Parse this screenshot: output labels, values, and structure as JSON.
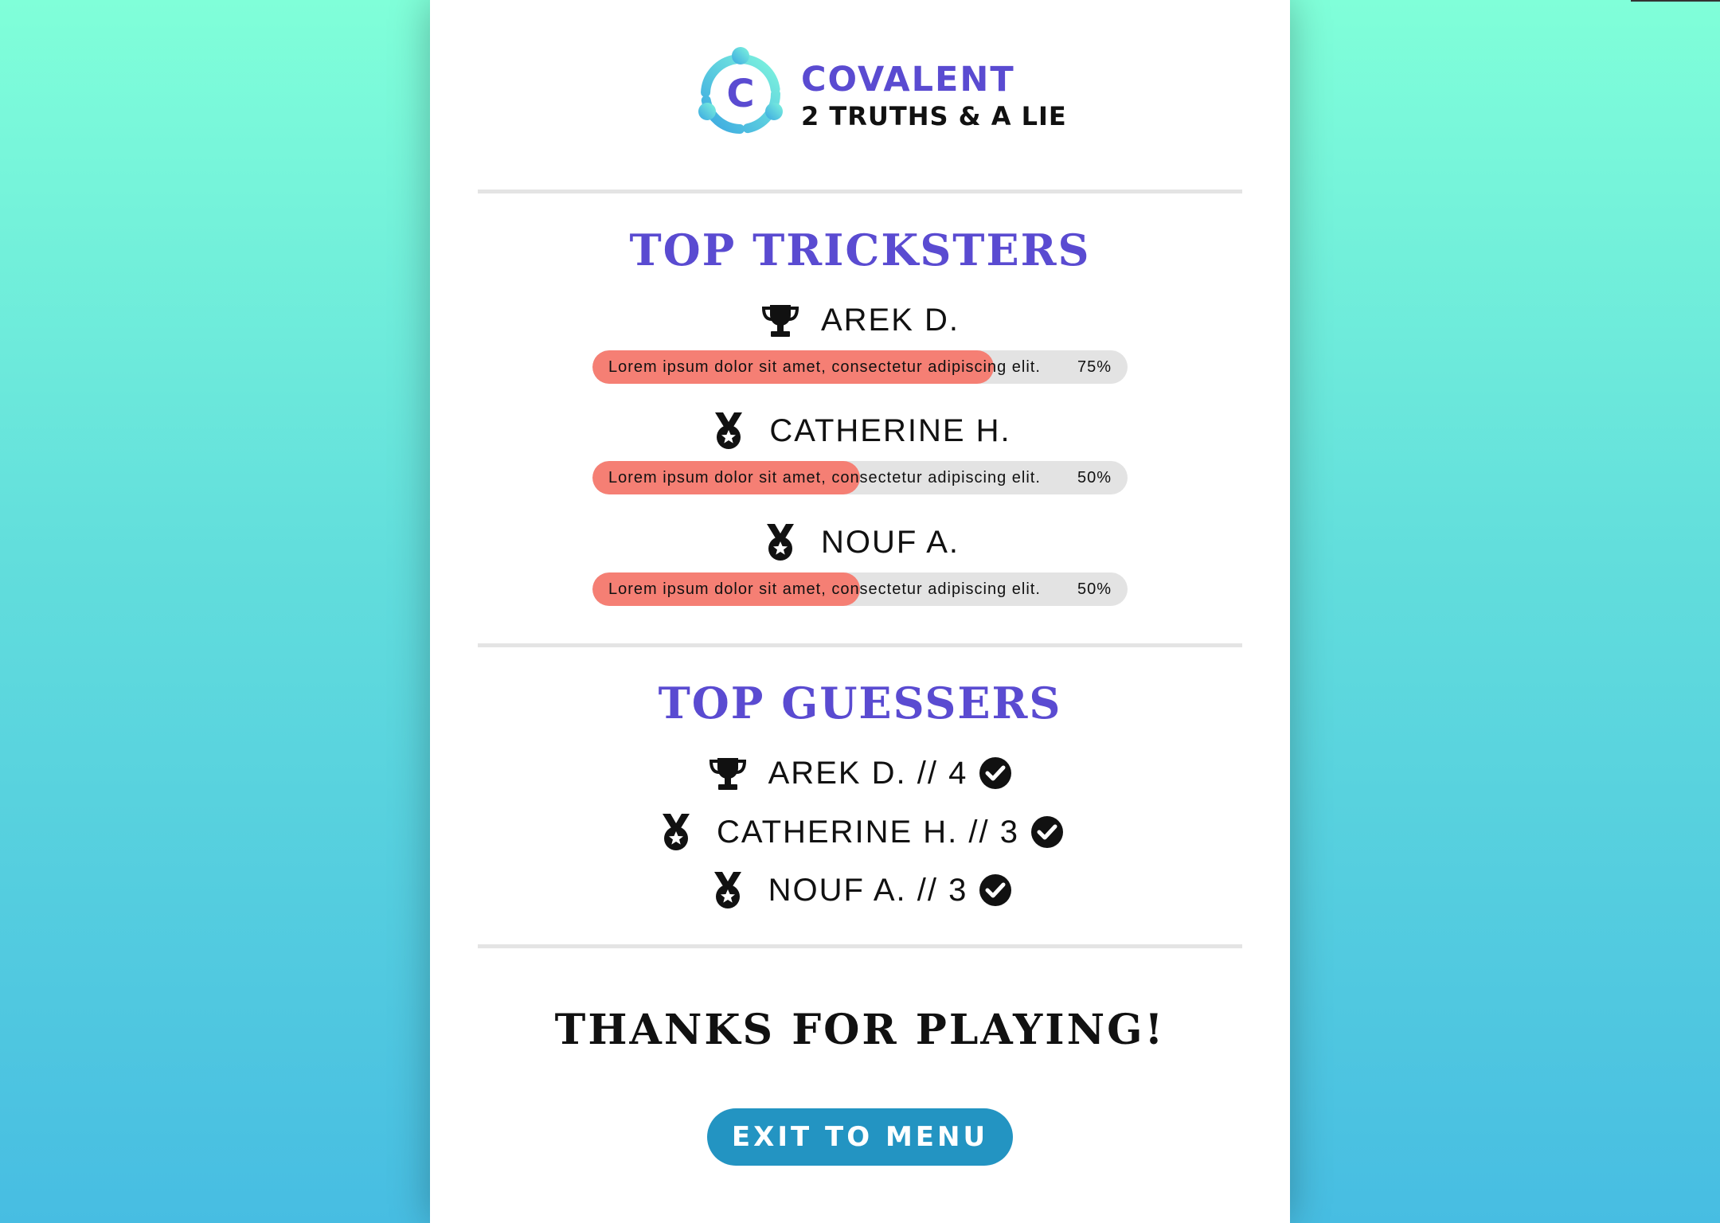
{
  "brand": {
    "name": "COVALENT",
    "subtitle": "2 TRUTHS & A LIE",
    "logo_letter": "C",
    "colors": {
      "accent": "#5a4bd1",
      "logo_gradient_start": "#7ff5de",
      "logo_gradient_end": "#3aa7e0"
    }
  },
  "tricksters": {
    "title": "TOP TRICKSTERS",
    "entries": [
      {
        "name": "AREK D.",
        "icon": "trophy-icon",
        "statement": "Lorem ipsum dolor sit amet, consectetur adipiscing elit.",
        "percent_label": "75%",
        "percent": 0.75
      },
      {
        "name": "CATHERINE H.",
        "icon": "medal-icon",
        "statement": "Lorem ipsum dolor sit amet, consectetur adipiscing elit.",
        "percent_label": "50%",
        "percent": 0.5
      },
      {
        "name": "NOUF A.",
        "icon": "medal-icon",
        "statement": "Lorem ipsum dolor sit amet, consectetur adipiscing elit.",
        "percent_label": "50%",
        "percent": 0.5
      }
    ],
    "colors": {
      "bar_fill": "#f57f74",
      "bar_track": "#e3e3e3"
    }
  },
  "guessers": {
    "title": "TOP GUESSERS",
    "entries": [
      {
        "label": "AREK D. // 4",
        "icon": "trophy-icon",
        "status_icon": "check-circle-icon"
      },
      {
        "label": "CATHERINE H. // 3",
        "icon": "medal-icon",
        "status_icon": "check-circle-icon"
      },
      {
        "label": "NOUF A. // 3",
        "icon": "medal-icon",
        "status_icon": "check-circle-icon"
      }
    ]
  },
  "footer": {
    "thanks": "THANKS FOR PLAYING!",
    "exit_label": "EXIT TO MENU",
    "button_color": "#2394c2"
  }
}
